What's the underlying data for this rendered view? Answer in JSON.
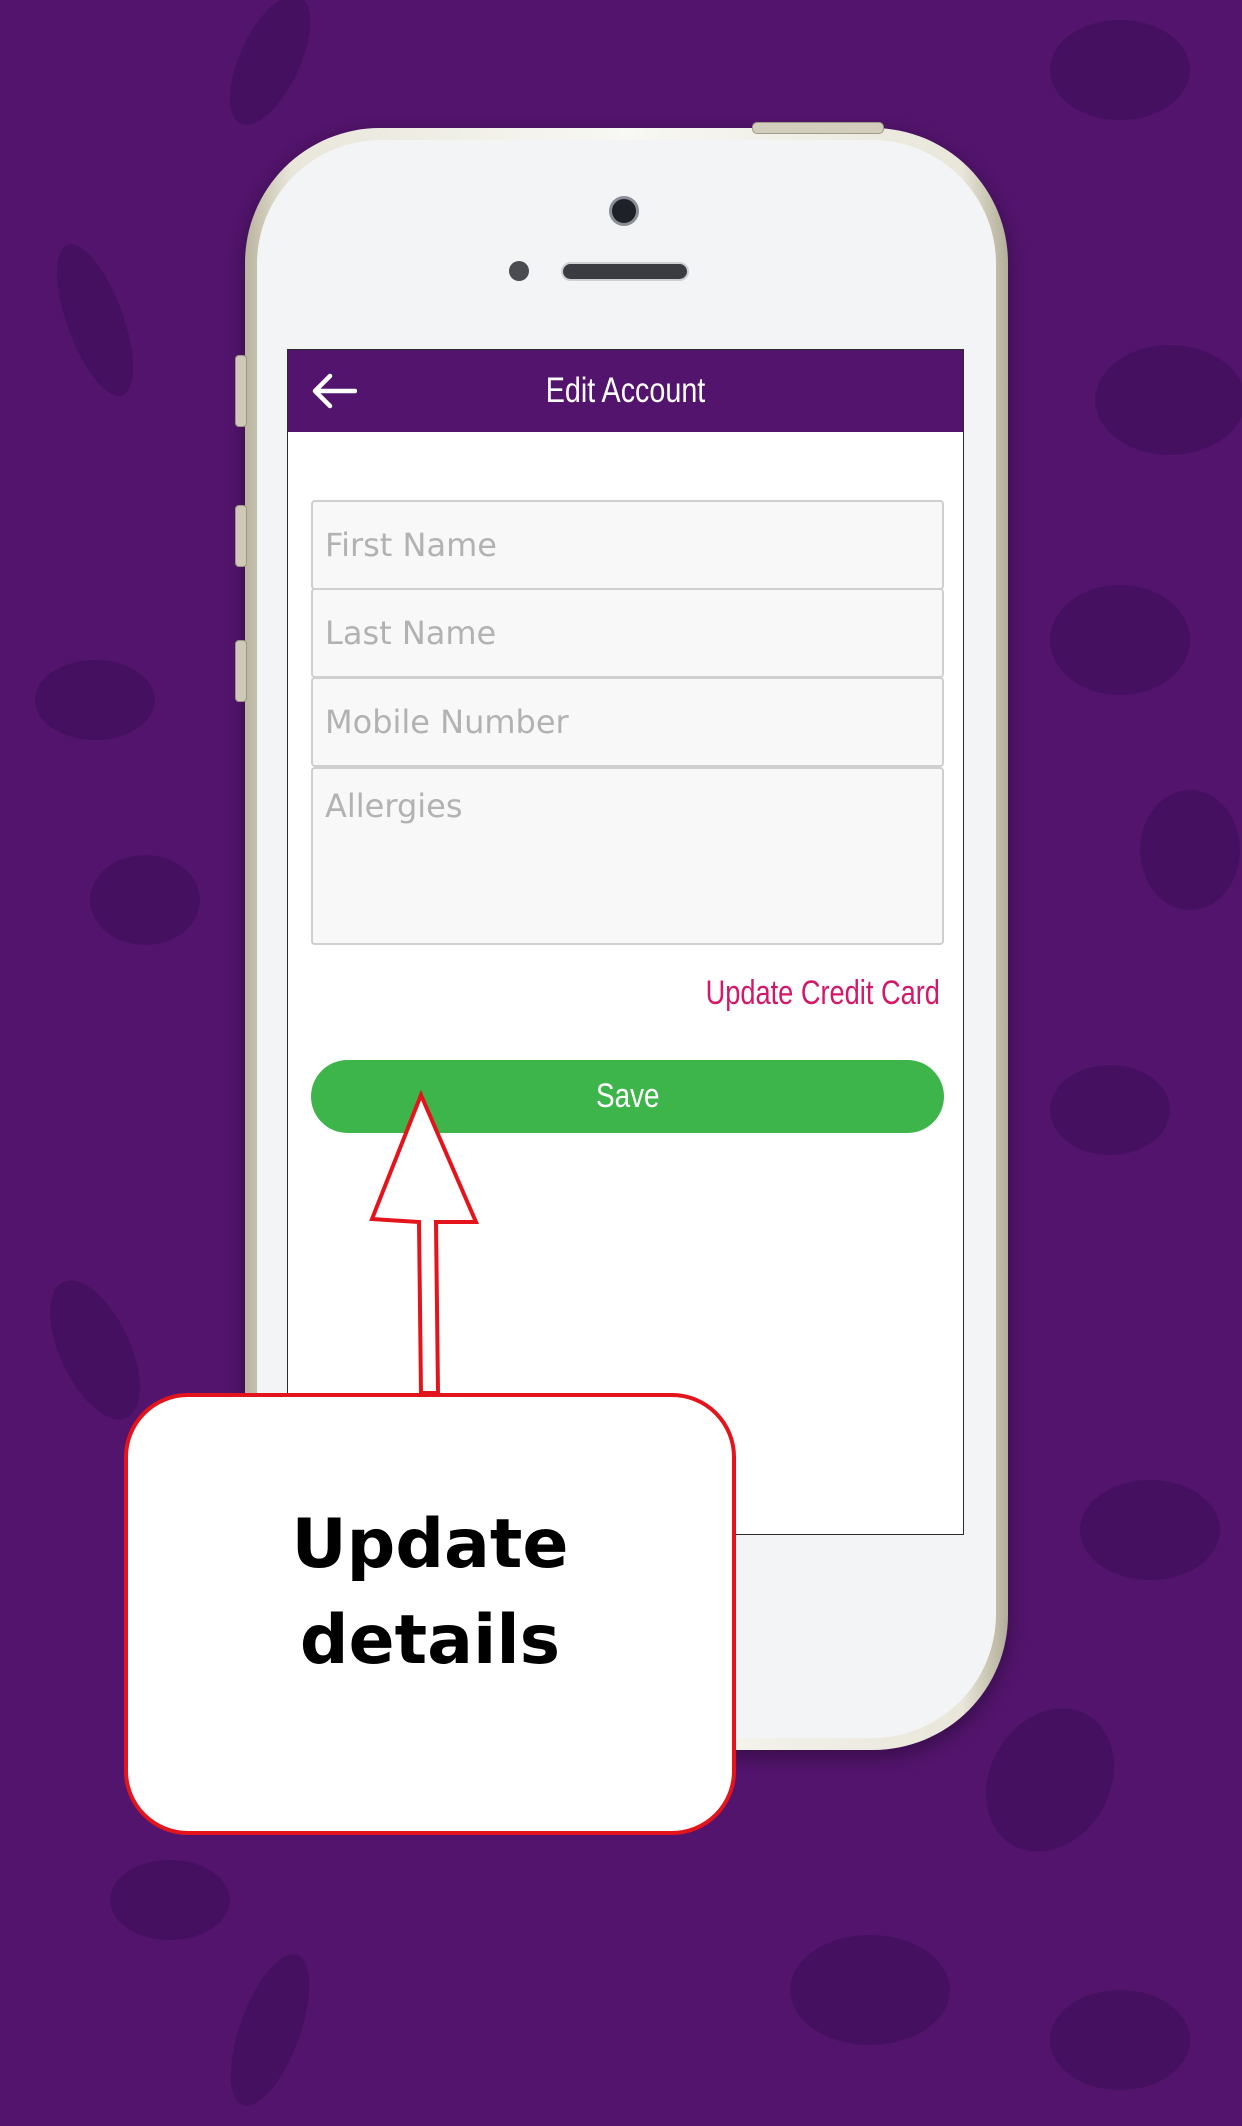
{
  "header": {
    "title": "Edit Account",
    "back_icon": "arrow-left-icon"
  },
  "form": {
    "first_name": {
      "placeholder": "First Name",
      "value": ""
    },
    "last_name": {
      "placeholder": "Last Name",
      "value": ""
    },
    "mobile_number": {
      "placeholder": "Mobile Number",
      "value": ""
    },
    "allergies": {
      "placeholder": "Allergies",
      "value": ""
    }
  },
  "links": {
    "update_credit_card": "Update Credit Card"
  },
  "buttons": {
    "save": "Save"
  },
  "annotation": {
    "callout_text": "Update details"
  },
  "colors": {
    "background": "#52146c",
    "app_bar": "#52146c",
    "link": "#d1186b",
    "save_button": "#3db54a",
    "callout_border": "#e3141c"
  }
}
